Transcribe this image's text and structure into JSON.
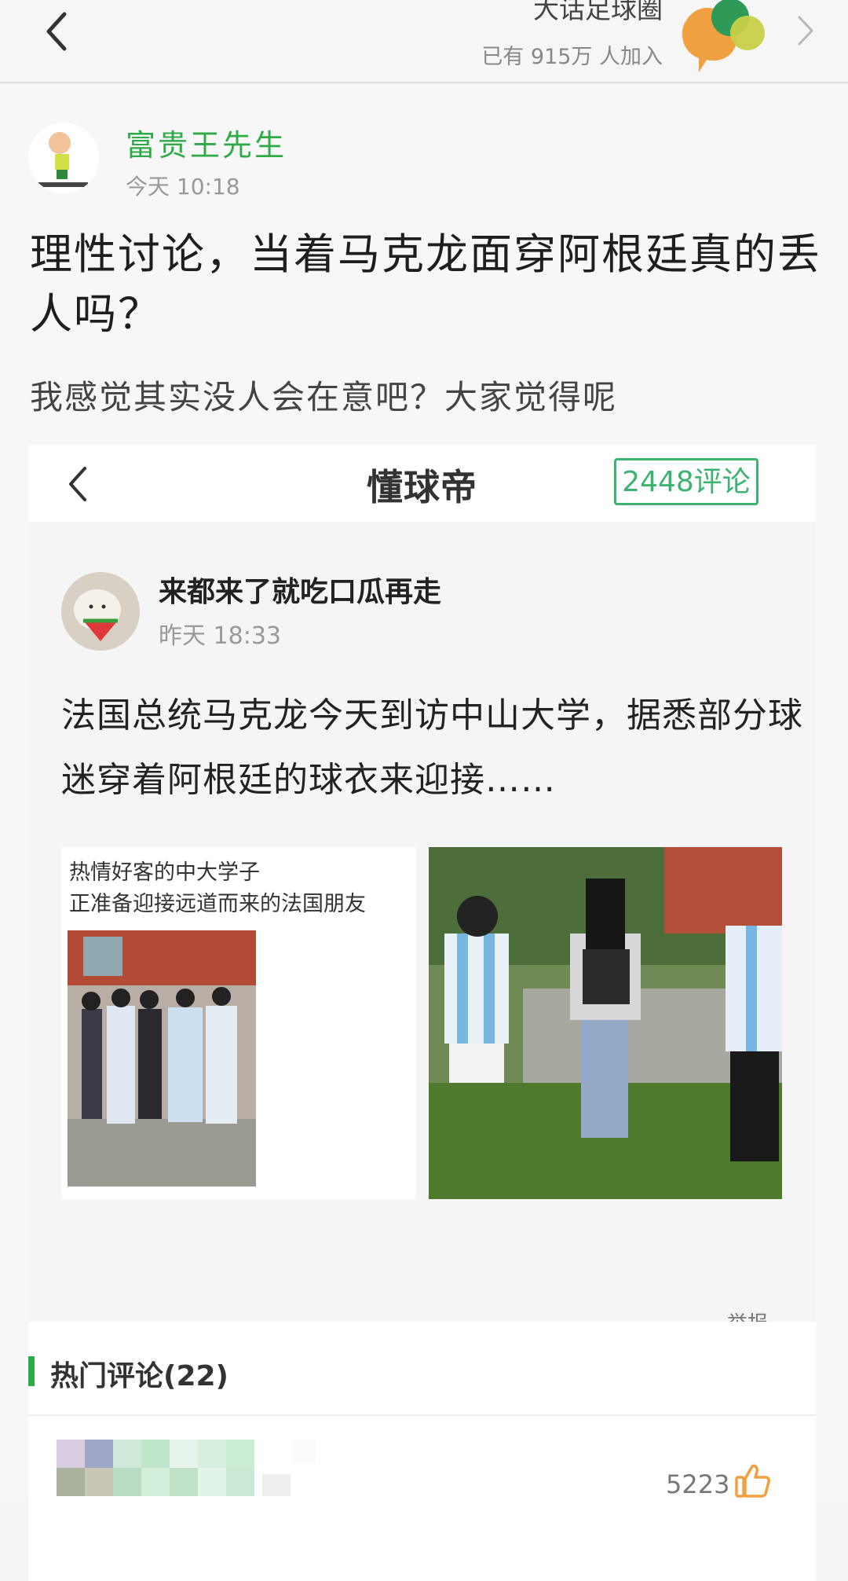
{
  "header": {
    "circle_name": "大话足球圈",
    "members": "已有 915万 人加入"
  },
  "post": {
    "author": "富贵王先生",
    "time": "今天 10:18",
    "title": "理性讨论，当着马克龙面穿阿根廷真的丢人吗？",
    "subtitle": "我感觉其实没人会在意吧？大家觉得呢"
  },
  "embedded": {
    "app_name": "懂球帝",
    "comment_count": "2448评论",
    "user": "来都来了就吃口瓜再走",
    "time": "昨天 18:33",
    "text": "法国总统马克龙今天到访中山大学，据悉部分球迷穿着阿根廷的球衣来迎接……",
    "left_caption_1": "热情好客的中大学子",
    "left_caption_2": "正准备迎接远道而来的法国朋友",
    "more": "举报"
  },
  "hot_comments": {
    "title": "热门评论(22)",
    "first_likes": "5223"
  },
  "colors": {
    "accent_green": "#2eaa47",
    "count_border": "#3cb371"
  },
  "icons": [
    "back-arrow-icon",
    "chevron-right-icon",
    "thumbs-up-icon"
  ]
}
